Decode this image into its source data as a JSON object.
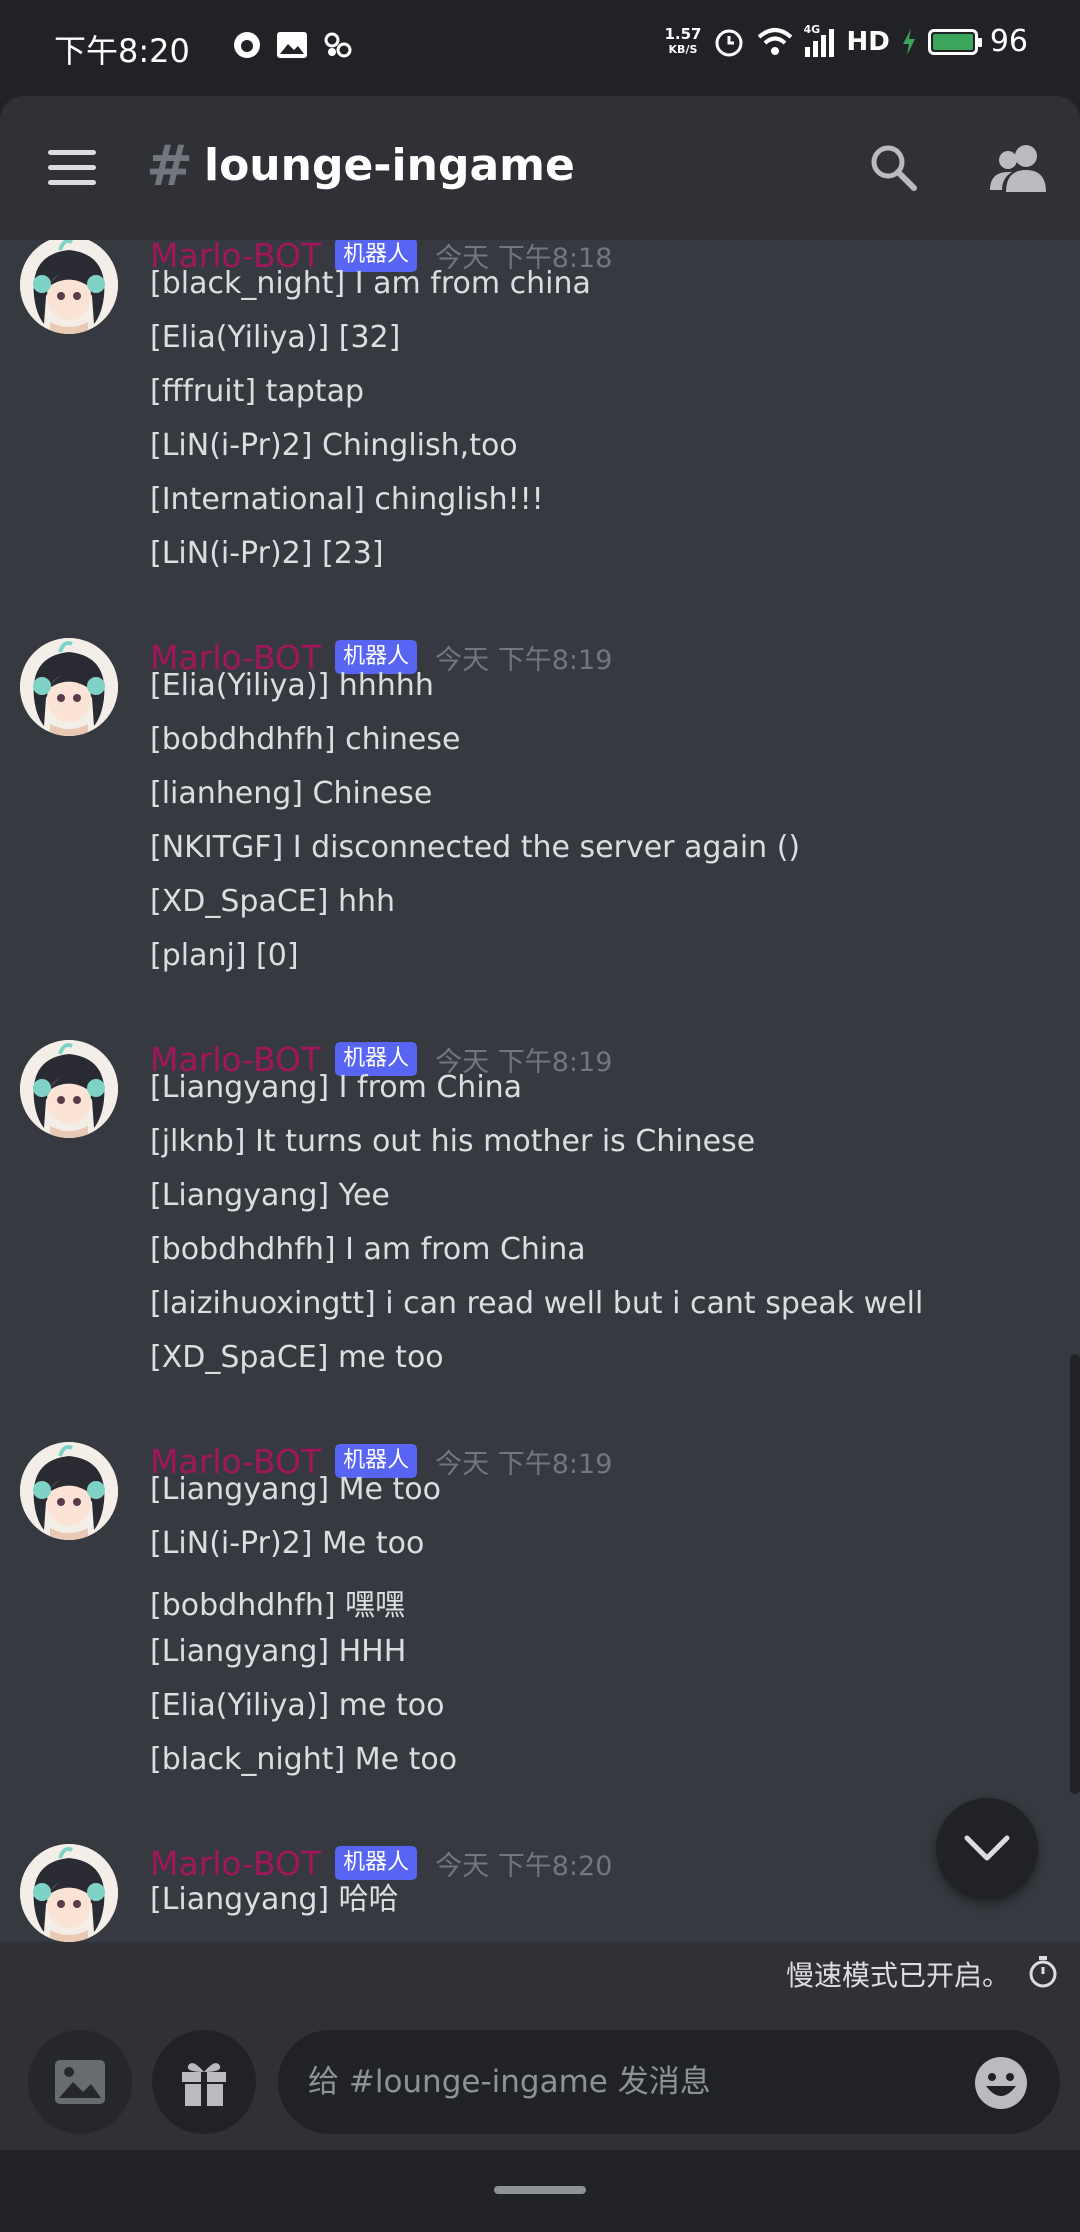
{
  "status_bar": {
    "time": "下午8:20",
    "net_speed_value": "1.57",
    "net_speed_unit": "KB/S",
    "network_label": "4G",
    "hd_label": "HD",
    "battery": "96"
  },
  "header": {
    "channel_hash": "#",
    "channel_name": "lounge-ingame"
  },
  "bot_tag": "机器人",
  "messages": [
    {
      "username": "Marlo-BOT",
      "time": "今天 下午8:18",
      "lines": [
        "[black_night] I am from china",
        "[Elia(Yiliya)] [32]",
        "[fffruit] taptap",
        "[LiN(i-Pr)2] Chinglish,too",
        "[International] chinglish!!!",
        "[LiN(i-Pr)2] [23]"
      ]
    },
    {
      "username": "Marlo-BOT",
      "time": "今天 下午8:19",
      "lines": [
        "[Elia(Yiliya)] hhhhh",
        "[bobdhdhfh] chinese",
        "[lianheng] Chinese",
        "[NKITGF] I disconnected the server again ()",
        "[XD_SpaCE] hhh",
        "[planj] [0]"
      ]
    },
    {
      "username": "Marlo-BOT",
      "time": "今天 下午8:19",
      "lines": [
        "[Liangyang] I from China",
        "[jlknb] It turns out his mother is Chinese",
        "[Liangyang] Yee",
        "[bobdhdhfh] I am from China",
        "[laizihuoxingtt] i can read well but i cant speak well",
        "[XD_SpaCE] me too"
      ]
    },
    {
      "username": "Marlo-BOT",
      "time": "今天 下午8:19",
      "lines": [
        "[Liangyang] Me too",
        "[LiN(i-Pr)2] Me too",
        "[bobdhdhfh] 嘿嘿",
        "[Liangyang] HHH",
        "[Elia(Yiliya)] me too",
        "[black_night] Me too"
      ]
    },
    {
      "username": "Marlo-BOT",
      "time": "今天 下午8:20",
      "lines": [
        "[Liangyang] 哈哈"
      ]
    }
  ],
  "slowmode": {
    "text": "慢速模式已开启。"
  },
  "composer": {
    "placeholder": "给 #lounge-ingame 发消息"
  },
  "colors": {
    "background": "#36393f",
    "header": "#2f3136",
    "username": "#a3175a",
    "bot_tag": "#5865f2",
    "status_bar": "#202225"
  }
}
